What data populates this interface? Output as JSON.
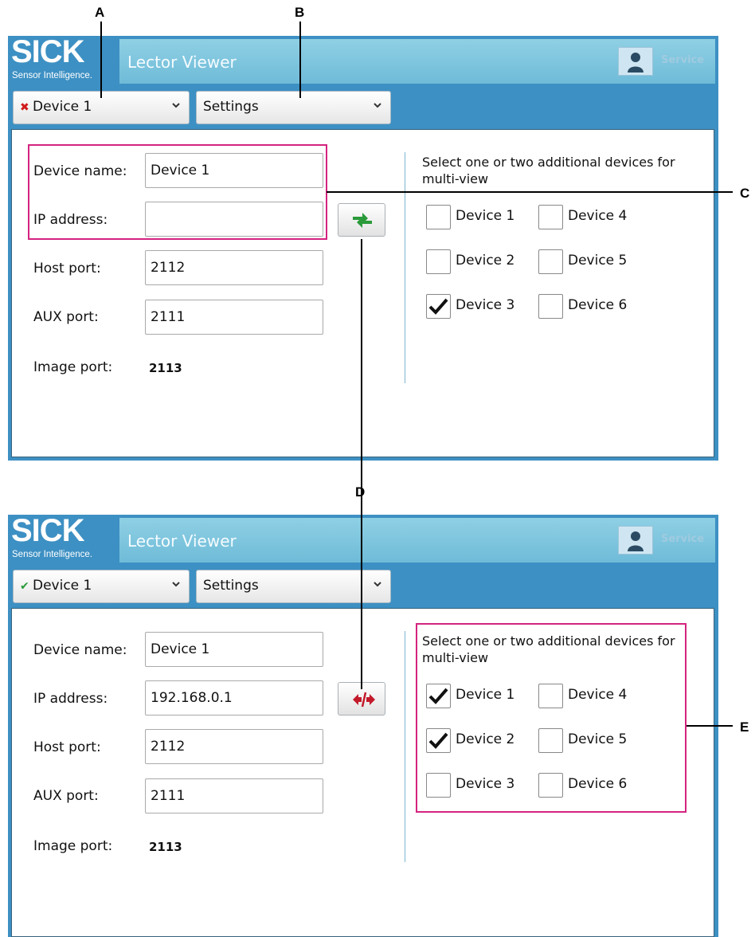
{
  "callouts": {
    "a": "A",
    "b": "B",
    "c": "C",
    "d": "D",
    "e": "E"
  },
  "colors": {
    "brand_blue": "#3d90c3",
    "title_bar": "#7ec5df",
    "highlight": "#d4237e",
    "disconnected_red": "#d11a1a",
    "connected_green": "#2a9a3a"
  },
  "screens": [
    {
      "logo": {
        "word": "SICK",
        "tagline": "Sensor Intelligence."
      },
      "app_title": "Lector Viewer",
      "user": {
        "icon": "user-icon",
        "role": "Service"
      },
      "device_dropdown": {
        "status_icon": "cross-icon",
        "status_mark": "✖",
        "value": "Device 1"
      },
      "settings_dropdown": {
        "value": "Settings"
      },
      "form": {
        "device_name_label": "Device name:",
        "device_name_value": "Device 1",
        "ip_label": "IP address:",
        "ip_value": "",
        "host_port_label": "Host port:",
        "host_port_value": "2112",
        "aux_port_label": "AUX port:",
        "aux_port_value": "2111",
        "image_port_label": "Image port:",
        "image_port_value": "2113"
      },
      "connect_button": {
        "icon": "connect-icon"
      },
      "multiview": {
        "title": "Select one or two additional devices for multi-view",
        "devices": [
          {
            "label": "Device 1",
            "checked": false
          },
          {
            "label": "Device 4",
            "checked": false
          },
          {
            "label": "Device 2",
            "checked": false
          },
          {
            "label": "Device 5",
            "checked": false
          },
          {
            "label": "Device 3",
            "checked": true
          },
          {
            "label": "Device 6",
            "checked": false
          }
        ]
      }
    },
    {
      "logo": {
        "word": "SICK",
        "tagline": "Sensor Intelligence."
      },
      "app_title": "Lector Viewer",
      "user": {
        "icon": "user-icon",
        "role": "Service"
      },
      "device_dropdown": {
        "status_icon": "checkmark-icon",
        "status_mark": "✔",
        "value": "Device 1"
      },
      "settings_dropdown": {
        "value": "Settings"
      },
      "form": {
        "device_name_label": "Device name:",
        "device_name_value": "Device 1",
        "ip_label": "IP address:",
        "ip_value": "192.168.0.1",
        "host_port_label": "Host port:",
        "host_port_value": "2112",
        "aux_port_label": "AUX port:",
        "aux_port_value": "2111",
        "image_port_label": "Image port:",
        "image_port_value": "2113"
      },
      "connect_button": {
        "icon": "disconnect-icon"
      },
      "multiview": {
        "title": "Select one or two additional devices for multi-view",
        "devices": [
          {
            "label": "Device 1",
            "checked": true
          },
          {
            "label": "Device 4",
            "checked": false
          },
          {
            "label": "Device 2",
            "checked": true
          },
          {
            "label": "Device 5",
            "checked": false
          },
          {
            "label": "Device 3",
            "checked": false
          },
          {
            "label": "Device 6",
            "checked": false
          }
        ]
      }
    }
  ]
}
